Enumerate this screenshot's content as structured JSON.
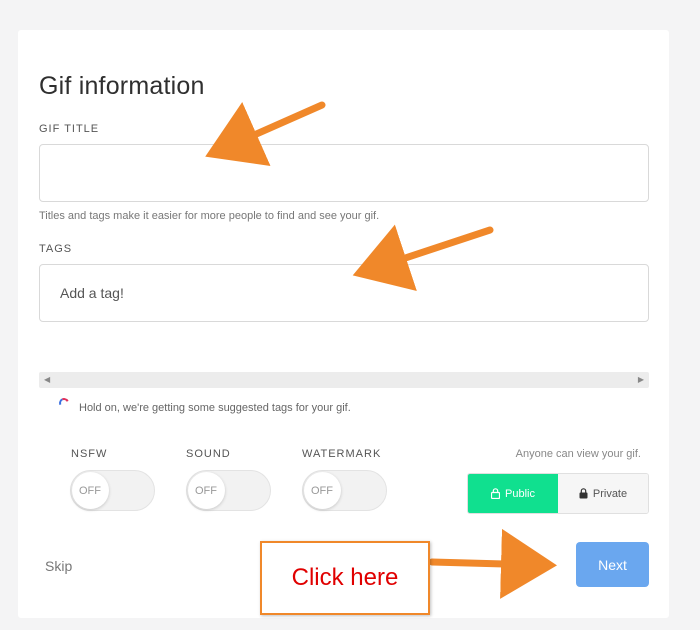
{
  "form": {
    "title": "Gif information",
    "gif_title_label": "GIF TITLE",
    "gif_title_value": "",
    "helper_text": "Titles and tags make it easier for more people to find and see your gif.",
    "tags_label": "TAGS",
    "tags_placeholder": "Add a tag!",
    "loading_text": "Hold on, we're getting some suggested tags for your gif."
  },
  "toggles": [
    {
      "label": "NSFW",
      "state": "OFF"
    },
    {
      "label": "SOUND",
      "state": "OFF"
    },
    {
      "label": "WATERMARK",
      "state": "OFF"
    }
  ],
  "visibility": {
    "note": "Anyone can view your gif.",
    "public_label": "Public",
    "private_label": "Private",
    "selected": "Public"
  },
  "footer": {
    "skip_label": "Skip",
    "next_label": "Next"
  },
  "annotation": {
    "callout_text": "Click here",
    "arrow_color": "#f0882a"
  },
  "colors": {
    "public_active": "#10e08f",
    "next_button": "#6aa7ef"
  },
  "icons": {
    "left_arrow": "scroll-left-icon",
    "right_arrow": "scroll-right-icon",
    "lock": "lock-icon"
  }
}
